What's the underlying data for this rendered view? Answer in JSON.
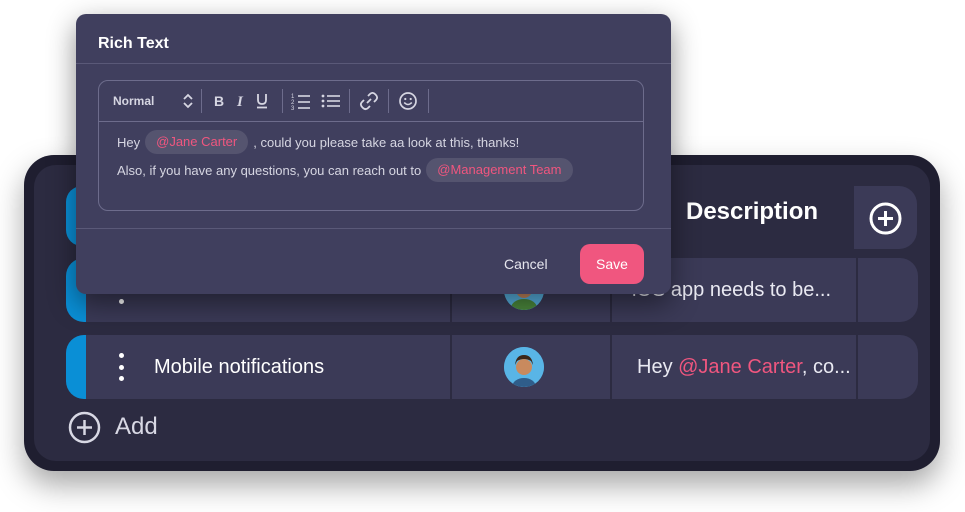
{
  "modal": {
    "title": "Rich Text",
    "toolbar": {
      "style_select": "Normal",
      "icons": [
        "bold-icon",
        "italic-icon",
        "underline-icon",
        "ordered-list-icon",
        "bullet-list-icon",
        "link-icon",
        "emoji-icon"
      ]
    },
    "content": {
      "line1_prefix": "Hey",
      "line1_mention": "@Jane Carter",
      "line1_suffix": ", could you please take aa look at this, thanks!",
      "line2_prefix": "Also, if you have any questions, you can reach out to",
      "line2_mention": "@Management Team"
    },
    "cancel_label": "Cancel",
    "save_label": "Save"
  },
  "board": {
    "column_header": "Description",
    "rows": [
      {
        "title": "",
        "description": "iOS app needs to be..."
      },
      {
        "title": "Mobile notifications",
        "description_prefix": "Hey ",
        "description_mention": "@Jane Carter",
        "description_suffix": ", co..."
      }
    ],
    "add_label": "Add"
  },
  "colors": {
    "accent_pink": "#f0567f",
    "status_blue": "#0a8fd6",
    "modal_bg": "#403f5e",
    "board_bg": "#2c2b41"
  }
}
